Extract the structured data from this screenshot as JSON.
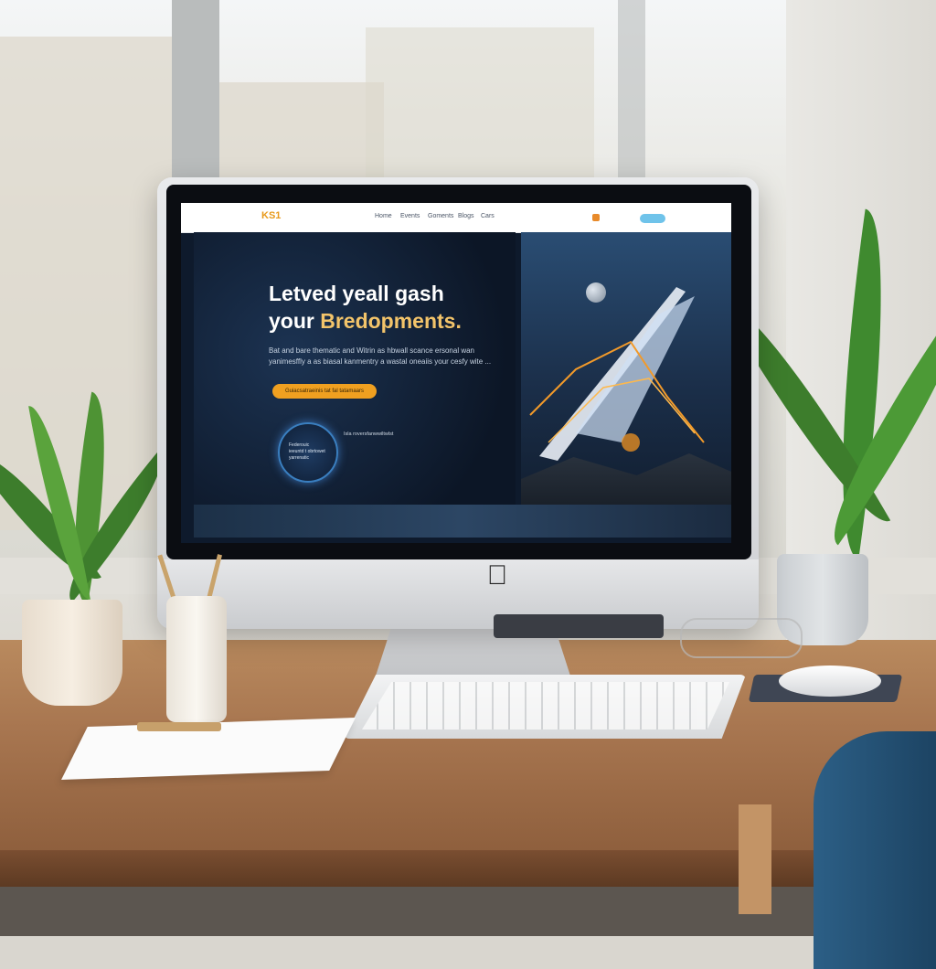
{
  "site": {
    "logo": "KS1",
    "nav_links": [
      "Home",
      "Events",
      "Goments",
      "Blogs",
      "Cars"
    ],
    "hero_title_line1": "Letved yeall gash",
    "hero_title_line2_prefix": "your ",
    "hero_title_line2_accent": "Bredopments.",
    "hero_body": "Bat and bare thematic and Witrin as hbwall scance ersonal wan yanimesffly a as biasal kanmentry a wastal oneaiis your cesfy wite ...",
    "cta_label": "Guiacsatraeinis tat fal tatamaars",
    "badge_text": "Federouic ieeuntd t obrtowet yarrenatic",
    "badge_caption": "Isla roversfanwwiltwlst"
  },
  "colors": {
    "accent_orange": "#f0a020",
    "hero_bg": "#0c1626",
    "nav_cta": "#6fc3ea"
  },
  "icons": [
    "apple-logo-icon",
    "cube-icon"
  ]
}
